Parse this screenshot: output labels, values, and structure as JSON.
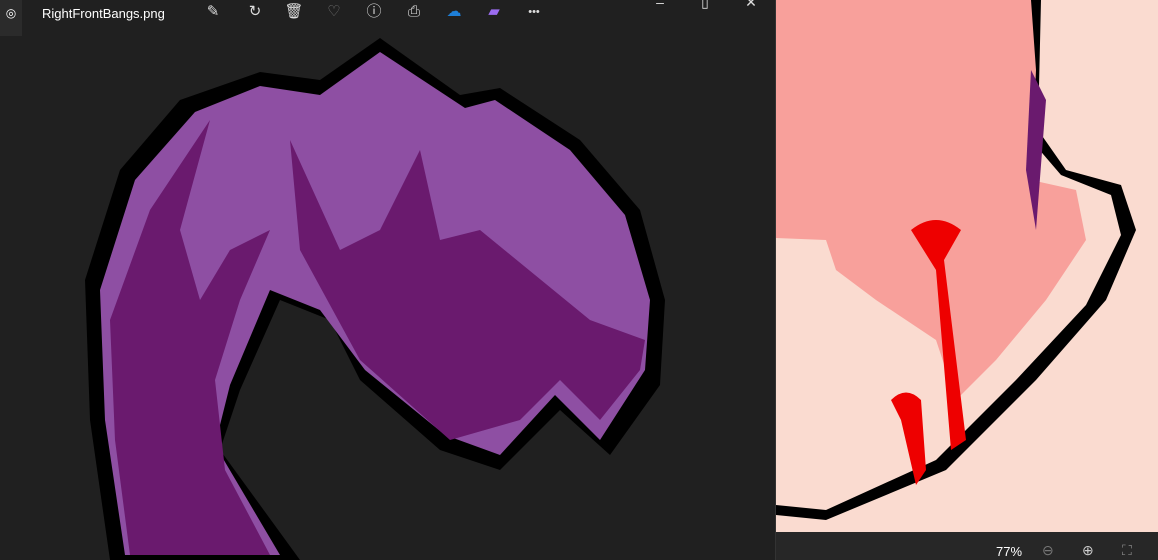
{
  "photos": {
    "file_name": "RightFrontBangs.png",
    "toolbar": [
      {
        "name": "edit-icon",
        "glyph": "✎"
      },
      {
        "name": "rotate-icon",
        "glyph": "↻"
      },
      {
        "name": "delete-icon",
        "glyph": "🗑"
      },
      {
        "name": "favorite-icon",
        "glyph": "♡"
      },
      {
        "name": "info-icon",
        "glyph": "ⓘ"
      },
      {
        "name": "print-icon",
        "glyph": "⎙"
      },
      {
        "name": "onedrive-icon",
        "glyph": "☁"
      },
      {
        "name": "clipchamp-icon",
        "glyph": "▰"
      },
      {
        "name": "more-icon",
        "glyph": "•••"
      }
    ],
    "minimize": "–",
    "maximize": "▯",
    "close": "✕"
  },
  "viewer": {
    "zoom": "77%",
    "zoom_out": "⊖",
    "zoom_in": "⊕",
    "fit": "⛶"
  },
  "colors": {
    "hair_light": "#8e4fa3",
    "hair_dark": "#6a1a6e",
    "skin": "#f8a09b",
    "skin_light": "#fcdcd2",
    "blood": "#ee0000"
  }
}
